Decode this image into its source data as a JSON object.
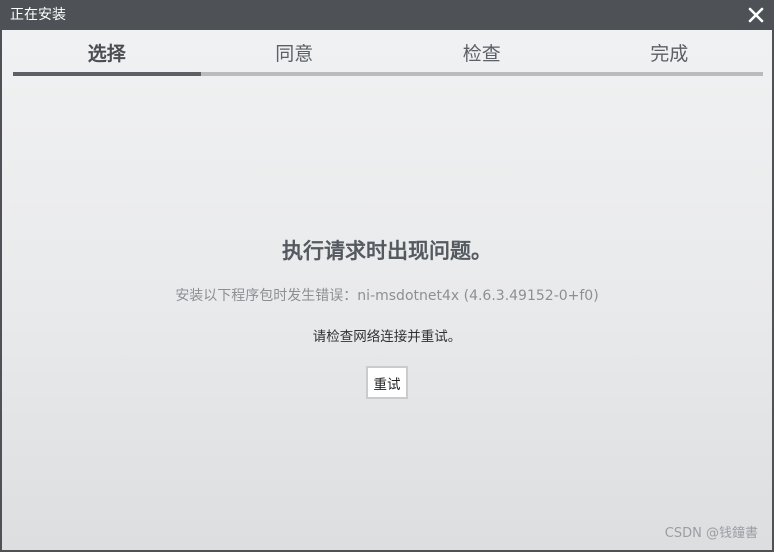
{
  "window": {
    "title": "正在安装",
    "close_icon": "close-icon"
  },
  "steps": [
    {
      "label": "选择",
      "active": true
    },
    {
      "label": "同意",
      "active": false
    },
    {
      "label": "检查",
      "active": false
    },
    {
      "label": "完成",
      "active": false
    }
  ],
  "progress": {
    "fraction": 0.25
  },
  "error": {
    "title": "执行请求时出现问题。",
    "detail": "安装以下程序包时发生错误：ni-msdotnet4x (4.6.3.49152-0+f0)",
    "hint": "请检查网络连接并重试。",
    "retry_label": "重试"
  },
  "watermark": "CSDN @钱鐘書",
  "colors": {
    "titlebar": "#4e5257",
    "progress_fill": "#5d6166",
    "progress_track": "#b9bbbd"
  }
}
